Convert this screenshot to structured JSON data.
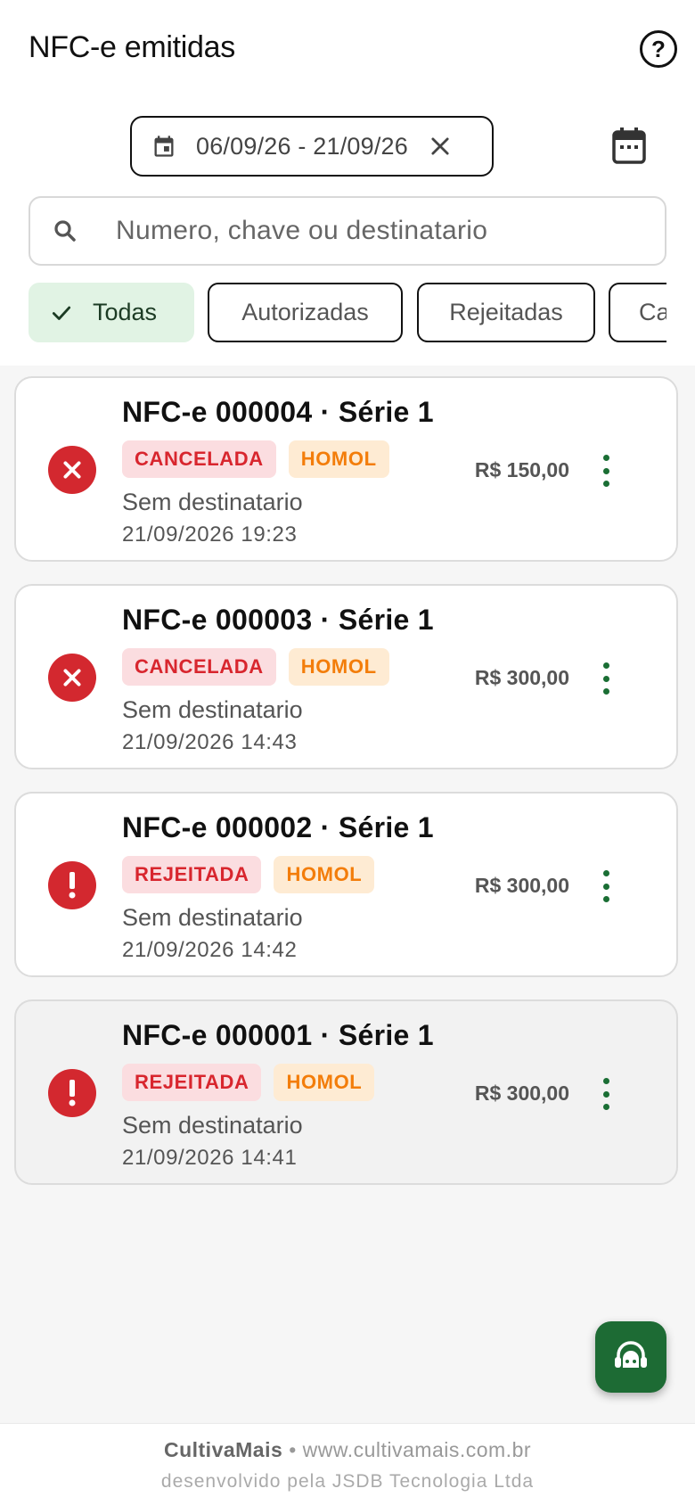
{
  "header": {
    "title": "NFC-e emitidas",
    "help_icon": "help-circle-icon"
  },
  "filters": {
    "date_range": "06/09/26 - 21/09/26",
    "search_placeholder": "Numero, chave ou destinatario",
    "chips": [
      {
        "label": "Todas",
        "selected": true
      },
      {
        "label": "Autorizadas",
        "selected": false
      },
      {
        "label": "Rejeitadas",
        "selected": false
      },
      {
        "label": "Ca",
        "selected": false
      }
    ]
  },
  "invoices": [
    {
      "title": "NFC-e 000004 · Série 1",
      "status": "CANCELADA",
      "status_icon": "x-circle-icon",
      "environment": "HOMOL",
      "recipient": "Sem destinatario",
      "datetime": "21/09/2026 19:23",
      "amount": "R$ 150,00"
    },
    {
      "title": "NFC-e 000003 · Série 1",
      "status": "CANCELADA",
      "status_icon": "x-circle-icon",
      "environment": "HOMOL",
      "recipient": "Sem destinatario",
      "datetime": "21/09/2026 14:43",
      "amount": "R$ 300,00"
    },
    {
      "title": "NFC-e 000002 · Série 1",
      "status": "REJEITADA",
      "status_icon": "alert-circle-icon",
      "environment": "HOMOL",
      "recipient": "Sem destinatario",
      "datetime": "21/09/2026 14:42",
      "amount": "R$ 300,00"
    },
    {
      "title": "NFC-e 000001 · Série 1",
      "status": "REJEITADA",
      "status_icon": "alert-circle-icon",
      "environment": "HOMOL",
      "recipient": "Sem destinatario",
      "datetime": "21/09/2026 14:41",
      "amount": "R$ 300,00"
    }
  ],
  "footer": {
    "brand": "CultivaMais",
    "site": "www.cultivamais.com.br",
    "developer": "desenvolvido pela JSDB Tecnologia Ltda"
  },
  "colors": {
    "accent_green": "#1d6b34",
    "status_red": "#d3282f",
    "badge_orange": "#f37d0a",
    "chip_selected_bg": "#e1f3e4"
  }
}
